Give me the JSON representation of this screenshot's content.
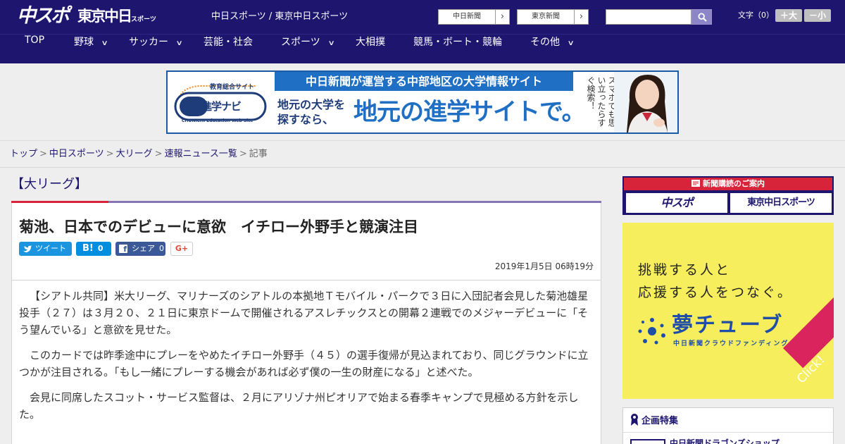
{
  "header": {
    "logo_chuspo": "中スポ",
    "logo_tokyo": "東京中日",
    "logo_tokyo_small": "スポーツ",
    "site_names": "中日スポーツ / 東京中日スポーツ",
    "links": [
      {
        "label": "中日新聞",
        "arrow": "›"
      },
      {
        "label": "東京新聞",
        "arrow": "›"
      }
    ],
    "search": {
      "value": "",
      "placeholder": "",
      "icon": "search-icon"
    },
    "font_size": {
      "label": "文字（0）",
      "bigger": "＋大",
      "smaller": "－小"
    }
  },
  "nav": {
    "items": [
      {
        "label": "TOP",
        "has_dropdown": false
      },
      {
        "label": "野球",
        "has_dropdown": true
      },
      {
        "label": "サッカー",
        "has_dropdown": true
      },
      {
        "label": "芸能・社会",
        "has_dropdown": false
      },
      {
        "label": "スポーツ",
        "has_dropdown": true
      },
      {
        "label": "大相撲",
        "has_dropdown": false
      },
      {
        "label": "競馬・ボート・競輪",
        "has_dropdown": false
      },
      {
        "label": "その他",
        "has_dropdown": true
      }
    ],
    "chevron": "∨"
  },
  "ad_top": {
    "logo_top": "教育総合サイト",
    "logo_main": "中日進学ナビ",
    "logo_en": "CHUNICHI Education Web Site",
    "headline": "中日新聞が運営する中部地区の大学情報サイト",
    "sub": "地元の大学を探すなら、",
    "main": "地元の進学サイトで。",
    "vertical": "スマホでも思い立ったらすぐ検索！"
  },
  "breadcrumb": {
    "items": [
      "トップ",
      "中日スポーツ",
      "大リーグ",
      "速報ニュース一覧"
    ],
    "current": "記事",
    "sep": ">"
  },
  "article": {
    "category": "【大リーグ】",
    "title": "菊池、日本でのデビューに意欲　イチロー外野手と競演注目",
    "share": {
      "twitter": {
        "label": "ツイート"
      },
      "hatena": {
        "label": "B!",
        "count": "0"
      },
      "facebook": {
        "label": "シェア",
        "count": "0"
      },
      "gplus": {
        "label": "G+"
      }
    },
    "date": "2019年1月5日 06時19分",
    "paragraphs": [
      "【シアトル共同】米大リーグ、マリナーズのシアトルの本拠地Ｔモバイル・パークで３日に入団記者会見した菊池雄星投手（２７）は３月２０、２１日に東京ドームで開催されるアスレチックスとの開幕２連戦でのメジャーデビューに「そう望んでいる」と意欲を見せた。",
      "このカードでは昨季途中にプレーをやめたイチロー外野手（４５）の選手復帰が見込まれており、同じグラウンドに立つかが注目される。「もし一緒にプレーする機会があれば必ず僕の一生の財産になる」と述べた。",
      "会見に同席したスコット・サービス監督は、２月にアリゾナ州ピオリアで始まる春季キャンプで見極める方針を示した。"
    ]
  },
  "sidebar": {
    "subscribe": {
      "title": "新聞購読のご案内",
      "logo1": "中スポ",
      "logo2": "東京中日スポーツ"
    },
    "yume": {
      "line1": "挑戦する人と",
      "line2": "応援する人をつなぐ。",
      "brand": "夢チューブ",
      "sub": "中日新聞クラウドファンディング",
      "click": "Click!"
    },
    "special": {
      "title": "企画特集",
      "item": "中日新聞ドラゴンズショップ"
    }
  },
  "colors": {
    "navy": "#1e156f",
    "accent_red": "#d7243a",
    "twitter": "#1b95e0",
    "hatena": "#008fde",
    "facebook": "#3b5998",
    "yume_bg": "#f6ee5d"
  }
}
